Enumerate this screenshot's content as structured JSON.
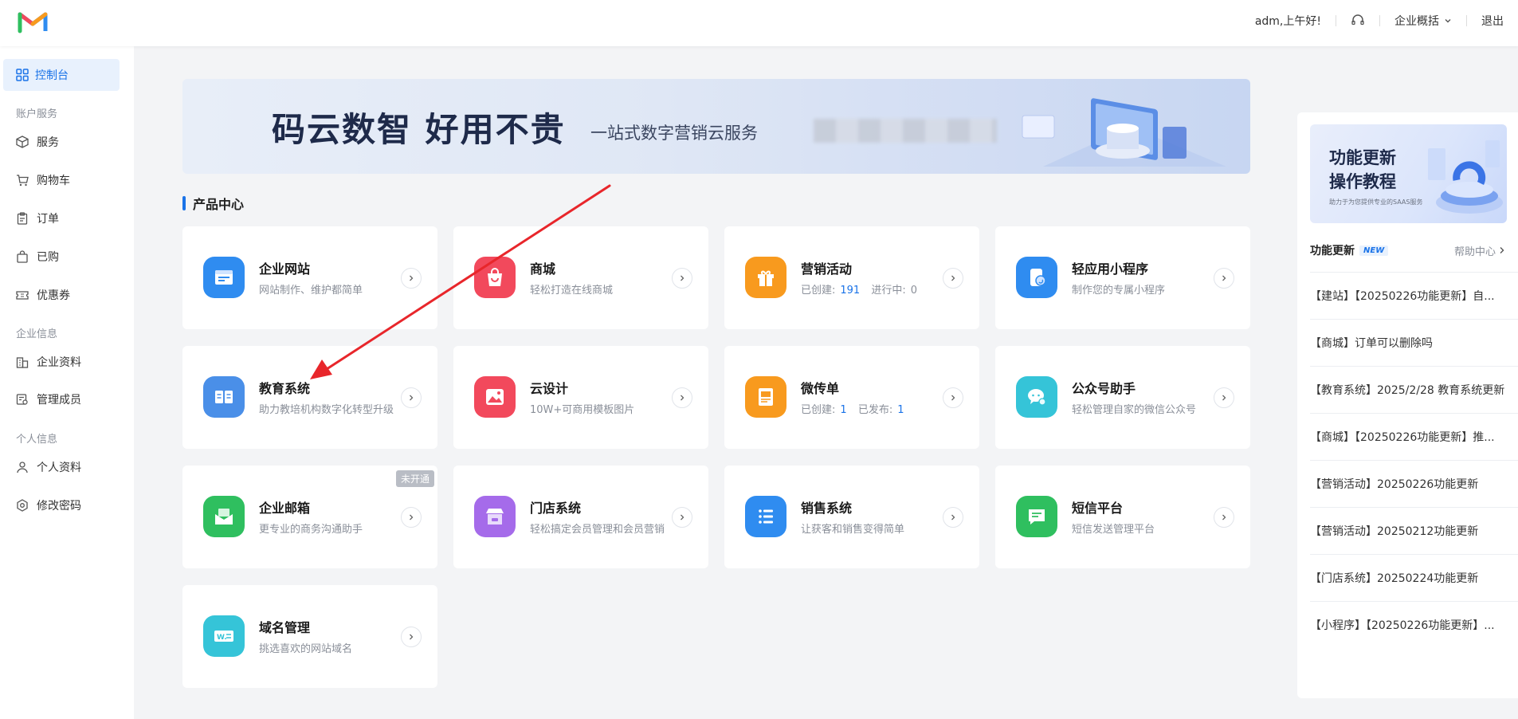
{
  "header": {
    "greeting": "adm,上午好!",
    "enterprise_menu": "企业概括",
    "logout": "退出",
    "icons": [
      "logo-m-icon",
      "headset-icon",
      "chevron-down-icon"
    ]
  },
  "sidebar": {
    "active": "控制台",
    "groups": [
      "账户服务",
      "企业信息",
      "个人信息"
    ],
    "items": [
      "服务",
      "购物车",
      "订单",
      "已购",
      "优惠券",
      "企业资料",
      "管理成员",
      "个人资料",
      "修改密码"
    ]
  },
  "banner": {
    "title": "码云数智  好用不贵",
    "subtitle": "一站式数字营销云服务"
  },
  "section_title": "产品中心",
  "products": [
    {
      "title": "企业网站",
      "desc": "网站制作、维护都简单",
      "color": "#2f8cf0",
      "icon": "website-icon"
    },
    {
      "title": "商城",
      "desc": "轻松打造在线商城",
      "color": "#f2495c",
      "icon": "shopping-bag-icon"
    },
    {
      "title": "营销活动",
      "desc_label1": "已创建:",
      "desc_value1": "191",
      "desc_label2": "进行中:",
      "desc_value2": "0",
      "color": "#f89a1e",
      "icon": "gift-icon"
    },
    {
      "title": "轻应用小程序",
      "desc": "制作您的专属小程序",
      "color": "#2f8cf0",
      "icon": "mini-program-icon"
    },
    {
      "title": "教育系统",
      "desc": "助力教培机构数字化转型升级",
      "color": "#4a8fe8",
      "icon": "book-icon"
    },
    {
      "title": "云设计",
      "desc": "10W+可商用模板图片",
      "color": "#f2495c",
      "icon": "image-icon"
    },
    {
      "title": "微传单",
      "desc_label1": "已创建:",
      "desc_value1": "1",
      "desc_label2": "已发布:",
      "desc_value2": "1",
      "color": "#f89a1e",
      "icon": "flyer-icon"
    },
    {
      "title": "公众号助手",
      "desc": "轻松管理自家的微信公众号",
      "color": "#35c4d8",
      "icon": "wechat-icon"
    },
    {
      "title": "企业邮箱",
      "desc": "更专业的商务沟通助手",
      "badge": "未开通",
      "color": "#2fbf5f",
      "icon": "mail-icon"
    },
    {
      "title": "门店系统",
      "desc": "轻松搞定会员管理和会员营销",
      "color": "#a56bea",
      "icon": "store-icon"
    },
    {
      "title": "销售系统",
      "desc": "让获客和销售变得简单",
      "color": "#2f8cf0",
      "icon": "list-icon"
    },
    {
      "title": "短信平台",
      "desc": "短信发送管理平台",
      "color": "#2fbf5f",
      "icon": "sms-icon"
    },
    {
      "title": "域名管理",
      "desc": "挑选喜欢的网站域名",
      "color": "#35c4d8",
      "icon": "domain-icon"
    }
  ],
  "right_panel": {
    "promo_line1": "功能更新",
    "promo_line2": "操作教程",
    "promo_small": "助力于为您提供专业的SAAS服务",
    "updates_title": "功能更新",
    "new_badge": "NEW",
    "help_center": "帮助中心",
    "updates": [
      "【建站】【20250226功能更新】自...",
      "【商城】订单可以删除吗",
      "【教育系统】2025/2/28 教育系统更新",
      "【商城】【20250226功能更新】推...",
      "【营销活动】20250226功能更新",
      "【营销活动】20250212功能更新",
      "【门店系统】20250224功能更新",
      "【小程序】【20250226功能更新】..."
    ]
  },
  "colors": {
    "accent": "#1a73e8",
    "annotation": "#e8262b"
  }
}
